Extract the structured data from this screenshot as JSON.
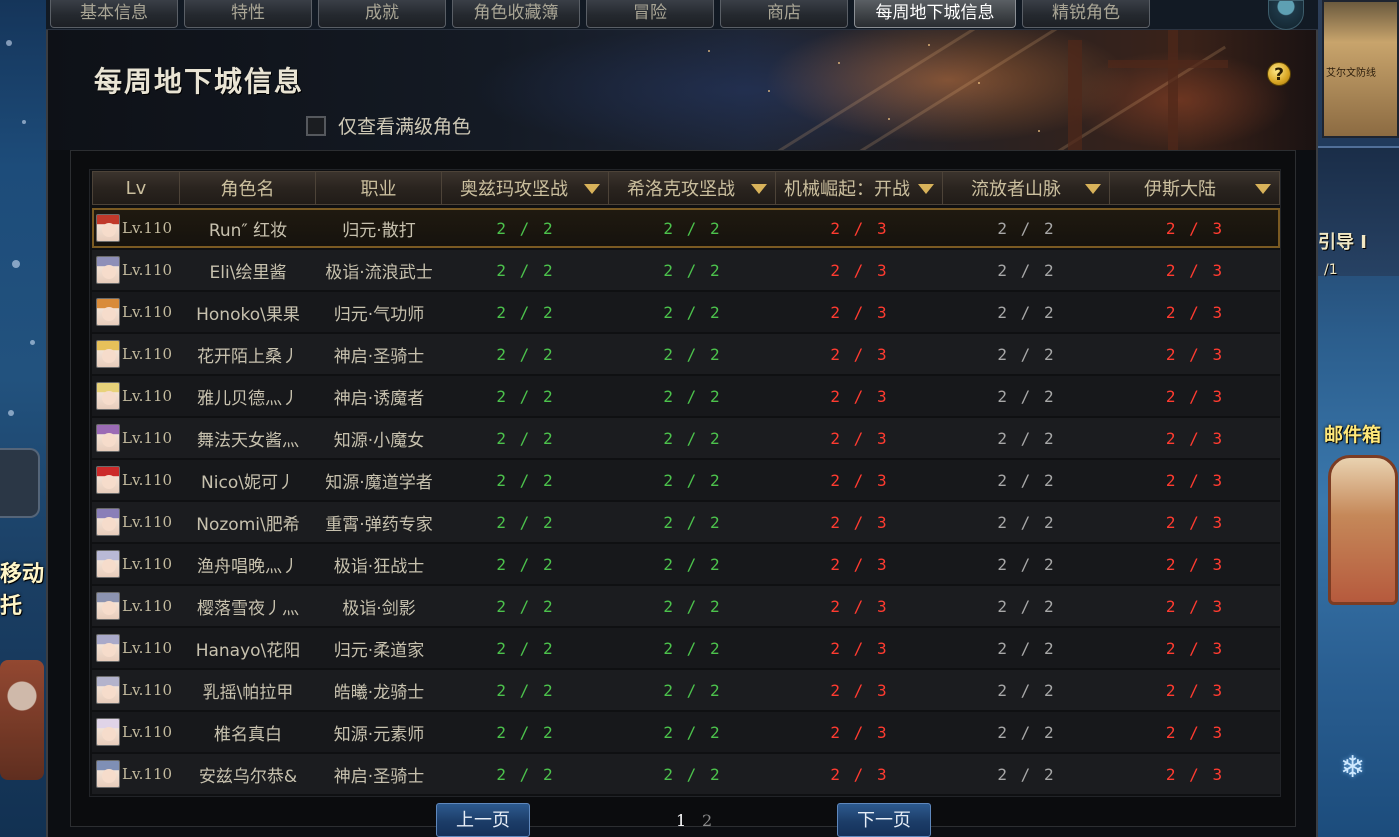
{
  "tabs": [
    {
      "label": "基本信息",
      "active": false
    },
    {
      "label": "特性",
      "active": false
    },
    {
      "label": "成就",
      "active": false
    },
    {
      "label": "角色收藏簿",
      "active": false
    },
    {
      "label": "冒险",
      "active": false
    },
    {
      "label": "商店",
      "active": false
    },
    {
      "label": "每周地下城信息",
      "active": true
    },
    {
      "label": "精锐角色",
      "active": false
    }
  ],
  "dialog": {
    "title": "每周地下城信息",
    "help_icon": "?",
    "filter_label": "仅查看满级角色",
    "filter_checked": false
  },
  "table": {
    "headers": [
      "Lv",
      "角色名",
      "职业",
      "奥兹玛攻坚战",
      "希洛克攻坚战",
      "机械崛起：开战",
      "流放者山脉",
      "伊斯大陆"
    ],
    "rows": [
      {
        "lv": "Lv.110",
        "name": "Run″ 红妆",
        "job": "归元·散打",
        "d": [
          "2 / 2",
          "2 / 2",
          "2 / 3",
          "2 / 2",
          "2 / 3"
        ],
        "avatar": "#c0392b",
        "selected": true
      },
      {
        "lv": "Lv.110",
        "name": "Eli\\绘里酱",
        "job": "极诣·流浪武士",
        "d": [
          "2 / 2",
          "2 / 2",
          "2 / 3",
          "2 / 2",
          "2 / 3"
        ],
        "avatar": "#8e8fb8"
      },
      {
        "lv": "Lv.110",
        "name": "Honoko\\果果",
        "job": "归元·气功师",
        "d": [
          "2 / 2",
          "2 / 2",
          "2 / 3",
          "2 / 2",
          "2 / 3"
        ],
        "avatar": "#d98b3a"
      },
      {
        "lv": "Lv.110",
        "name": "花开陌上桑丿",
        "job": "神启·圣骑士",
        "d": [
          "2 / 2",
          "2 / 2",
          "2 / 3",
          "2 / 2",
          "2 / 3"
        ],
        "avatar": "#e6c05a"
      },
      {
        "lv": "Lv.110",
        "name": "雅儿贝德灬丿",
        "job": "神启·诱魔者",
        "d": [
          "2 / 2",
          "2 / 2",
          "2 / 3",
          "2 / 2",
          "2 / 3"
        ],
        "avatar": "#e8d27a"
      },
      {
        "lv": "Lv.110",
        "name": "舞法天女酱灬",
        "job": "知源·小魔女",
        "d": [
          "2 / 2",
          "2 / 2",
          "2 / 3",
          "2 / 2",
          "2 / 3"
        ],
        "avatar": "#9b6bb5"
      },
      {
        "lv": "Lv.110",
        "name": "Nico\\妮可丿",
        "job": "知源·魔道学者",
        "d": [
          "2 / 2",
          "2 / 2",
          "2 / 3",
          "2 / 2",
          "2 / 3"
        ],
        "avatar": "#cc2a2a"
      },
      {
        "lv": "Lv.110",
        "name": "Nozomi\\肥希",
        "job": "重霄·弹药专家",
        "d": [
          "2 / 2",
          "2 / 2",
          "2 / 3",
          "2 / 2",
          "2 / 3"
        ],
        "avatar": "#8a7fb8"
      },
      {
        "lv": "Lv.110",
        "name": "渔舟唱晚灬丿",
        "job": "极诣·狂战士",
        "d": [
          "2 / 2",
          "2 / 2",
          "2 / 3",
          "2 / 2",
          "2 / 3"
        ],
        "avatar": "#b9b9d6"
      },
      {
        "lv": "Lv.110",
        "name": "樱落雪夜丿灬",
        "job": "极诣·剑影",
        "d": [
          "2 / 2",
          "2 / 2",
          "2 / 3",
          "2 / 2",
          "2 / 3"
        ],
        "avatar": "#8c93b0"
      },
      {
        "lv": "Lv.110",
        "name": "Hanayo\\花阳",
        "job": "归元·柔道家",
        "d": [
          "2 / 2",
          "2 / 2",
          "2 / 3",
          "2 / 2",
          "2 / 3"
        ],
        "avatar": "#a9a9c9"
      },
      {
        "lv": "Lv.110",
        "name": "乳摇\\帕拉甲",
        "job": "皓曦·龙骑士",
        "d": [
          "2 / 2",
          "2 / 2",
          "2 / 3",
          "2 / 2",
          "2 / 3"
        ],
        "avatar": "#b3b3cc"
      },
      {
        "lv": "Lv.110",
        "name": "椎名真白",
        "job": "知源·元素师",
        "d": [
          "2 / 2",
          "2 / 2",
          "2 / 3",
          "2 / 2",
          "2 / 3"
        ],
        "avatar": "#e0d4e8"
      },
      {
        "lv": "Lv.110",
        "name": "安兹乌尔恭&",
        "job": "神启·圣骑士",
        "d": [
          "2 / 2",
          "2 / 2",
          "2 / 3",
          "2 / 2",
          "2 / 3"
        ],
        "avatar": "#7f8fb5"
      }
    ],
    "column_colors": [
      "green",
      "green",
      "red",
      "gray",
      "red"
    ]
  },
  "pagination": {
    "prev_label": "上一页",
    "next_label": "下一页",
    "pages": [
      "1",
      "2"
    ],
    "current": "1"
  },
  "background": {
    "left_text_1": "移动",
    "left_text_2": "托",
    "map_label": "艾尔文防线",
    "right_label_a": "引导 I",
    "right_label_b": "/1",
    "mailbox_label": "邮件箱",
    "snowflake": "❄"
  },
  "colors": {
    "accent_gold": "#d8b25a",
    "clear_green": "#4cc24c",
    "incomplete_red": "#ff3b30",
    "neutral_gray": "#a7a7a7",
    "pager_blue": "#1c3d68"
  }
}
